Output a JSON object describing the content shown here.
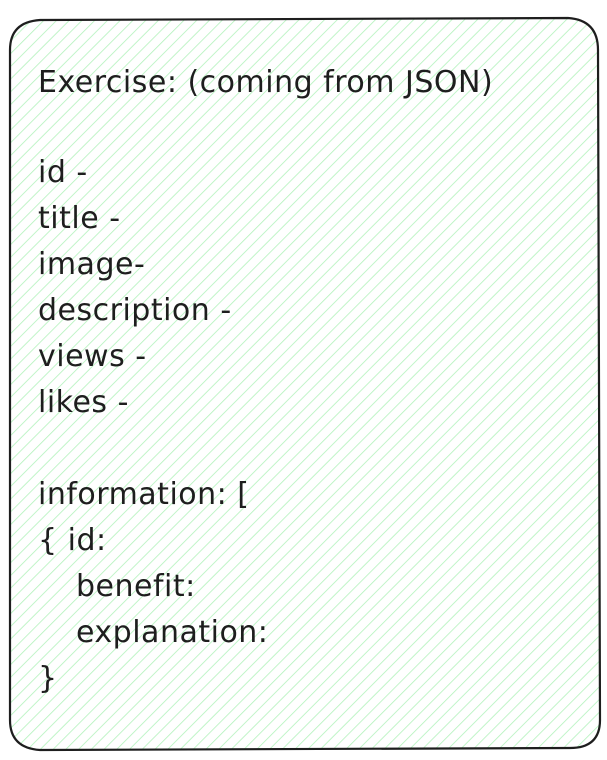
{
  "card": {
    "title": "Exercise: (coming from JSON)",
    "fields": [
      "id -",
      "title -",
      "image-",
      "description -",
      "views -",
      "likes -"
    ],
    "information_open": "information: [",
    "object_open": "{ id:",
    "object_fields": [
      "benefit:",
      "explanation:"
    ],
    "object_close": "}"
  },
  "colors": {
    "hatch": "#b2f2bb",
    "stroke": "#1e1e1e",
    "text": "#1e1e1e"
  }
}
